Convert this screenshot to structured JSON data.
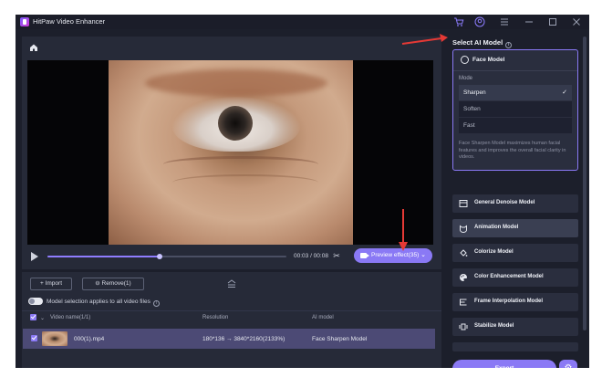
{
  "titlebar": {
    "app_title": "HitPaw Video Enhancer",
    "icons": [
      "cart-icon",
      "user-icon",
      "menu-icon"
    ],
    "window_controls": [
      "minimize-icon",
      "maximize-icon",
      "close-icon"
    ]
  },
  "player": {
    "time": "00:03 / 00:08",
    "progress": 0.47,
    "preview_label": "Preview effect(35)"
  },
  "files": {
    "import_label": "+ Import",
    "remove_label": "Remove(1)",
    "toggle_label": "Model selection applies to all video files",
    "columns": {
      "name": "Video name(1/1)",
      "resolution": "Resolution",
      "model": "AI model"
    },
    "rows": [
      {
        "name": "000(1).mp4",
        "resolution": "180*136 → 3840*2160(2133%)",
        "model": "Face Sharpen Model"
      }
    ]
  },
  "panel": {
    "title": "Select AI Model",
    "face_model": {
      "title": "Face Model",
      "mode_label": "Mode",
      "modes": [
        "Sharpen",
        "Soften",
        "Fast"
      ],
      "selected": "Sharpen",
      "description": "Face Sharpen Model maximizes human facial features and improves the overall facial clarity in videos."
    },
    "models": [
      "General Denoise Model",
      "Animation Model",
      "Colorize Model",
      "Color Enhancement Model",
      "Frame Interpolation Model",
      "Stabilize Model"
    ],
    "export_label": "Export"
  },
  "colors": {
    "accent": "#8a79f5",
    "annotation": "#e53935"
  }
}
